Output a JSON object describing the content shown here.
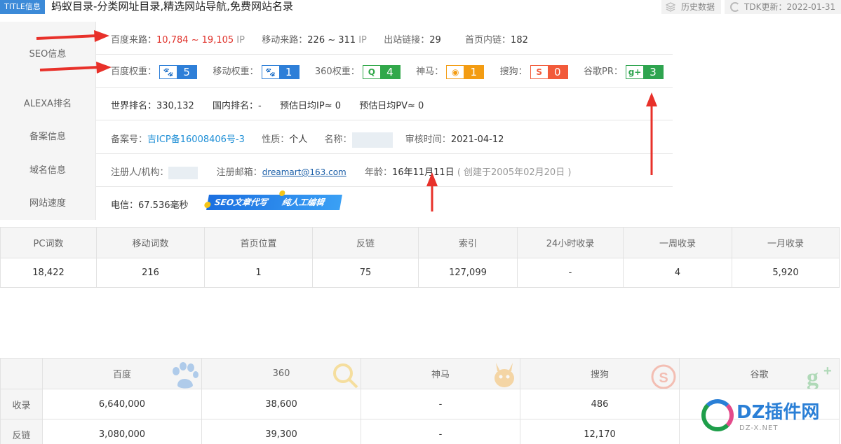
{
  "title": {
    "tag": "TITLE信息",
    "text": "蚂蚁目录-分类网址目录,精选网站导航,免费网站名录"
  },
  "toolbar": {
    "history": "历史数据",
    "tdk": "TDK更新：2022-01-31"
  },
  "seo": {
    "label": "SEO信息",
    "baidu_source_k": "百度来路：",
    "baidu_source_v": "10,784 ~ 19,105",
    "ip1": "IP",
    "mobile_source_k": "移动来路：",
    "mobile_source_v": "226 ~ 311",
    "ip2": "IP",
    "outlinks_k": "出站链接：",
    "outlinks_v": "29",
    "homelinks_k": "首页内链：",
    "homelinks_v": "182",
    "weights": [
      {
        "k": "百度权重：",
        "icon": "paw-icon",
        "v": "5"
      },
      {
        "k": "移动权重：",
        "icon": "paw-icon",
        "v": "1"
      },
      {
        "k": "360权重：",
        "icon": "360-icon",
        "v": "4"
      },
      {
        "k": "神马：",
        "icon": "shenma-icon",
        "v": "1"
      },
      {
        "k": "搜狗：",
        "icon": "sogou-icon",
        "v": "0"
      },
      {
        "k": "谷歌PR：",
        "icon": "google-plus-icon",
        "v": "3"
      }
    ]
  },
  "alexa": {
    "label": "ALEXA排名",
    "world": "世界排名：330,132",
    "domestic": "国内排名：-",
    "ip": "预估日均IP≈ 0",
    "pv": "预估日均PV≈ 0"
  },
  "beian": {
    "label": "备案信息",
    "no_k": "备案号：",
    "no_v": "吉ICP备16008406号-3",
    "nature_k": "性质：",
    "nature_v": "个人",
    "name_k": "名称：",
    "audit_k": "审核时间：",
    "audit_v": "2021-04-12"
  },
  "domain": {
    "label": "域名信息",
    "registrant_k": "注册人/机构：",
    "email_k": "注册邮箱：",
    "email_v": "dreamart@163.com",
    "age_k": "年龄：",
    "age_v": "16年11月11日",
    "created": "( 创建于2005年02月20日 )"
  },
  "speed": {
    "label": "网站速度",
    "telecom": "电信：67.536毫秒",
    "banner_left": "SEO文章代写",
    "banner_right": "纯人工编辑"
  },
  "stats": {
    "headers": [
      "PC词数",
      "移动词数",
      "首页位置",
      "反链",
      "索引",
      "24小时收录",
      "一周收录",
      "一月收录"
    ],
    "values": [
      "18,422",
      "216",
      "1",
      "75",
      "127,099",
      "-",
      "4",
      "5,920"
    ]
  },
  "engines": {
    "headers": [
      "百度",
      "360",
      "神马",
      "搜狗",
      "谷歌"
    ],
    "rows": [
      {
        "label": "收录",
        "values": [
          "6,640,000",
          "38,600",
          "-",
          "486",
          ""
        ]
      },
      {
        "label": "反链",
        "values": [
          "3,080,000",
          "39,300",
          "-",
          "12,170",
          ""
        ]
      }
    ]
  },
  "watermark": {
    "brand": "DZ插件网",
    "url": "DZ-X.NET"
  },
  "colors": {
    "accent_blue": "#3c8ad8",
    "red": "#e0312a",
    "badge_blue": "#2e7fd8",
    "badge_green": "#31a84a",
    "badge_orange": "#f39c12",
    "badge_red": "#f25a3a"
  }
}
